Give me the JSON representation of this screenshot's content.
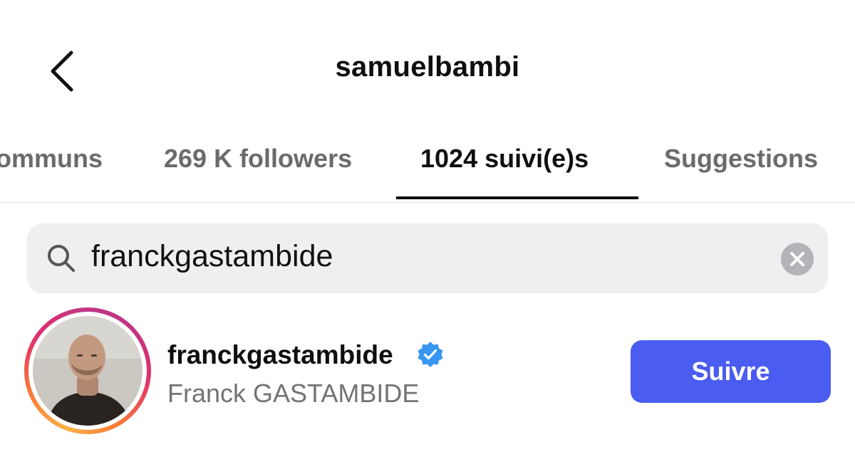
{
  "header": {
    "title": "samuelbambi",
    "back_icon": "chevron-left-icon"
  },
  "tabs": [
    {
      "label": "ommuns",
      "active": false
    },
    {
      "label": "269 K followers",
      "active": false
    },
    {
      "label": "1024 suivi(e)s",
      "active": true
    },
    {
      "label": "Suggestions",
      "active": false
    }
  ],
  "search": {
    "icon": "search-icon",
    "value": "franckgastambide",
    "clear_icon": "clear-icon"
  },
  "result": {
    "username": "franckgastambide",
    "verified": true,
    "full_name": "Franck GASTAMBIDE",
    "follow_label": "Suivre"
  },
  "colors": {
    "follow_button": "#4a5df0",
    "verified_badge": "#3897f0",
    "search_bg": "#efeff1",
    "inactive_tab": "#6b6b6b"
  }
}
